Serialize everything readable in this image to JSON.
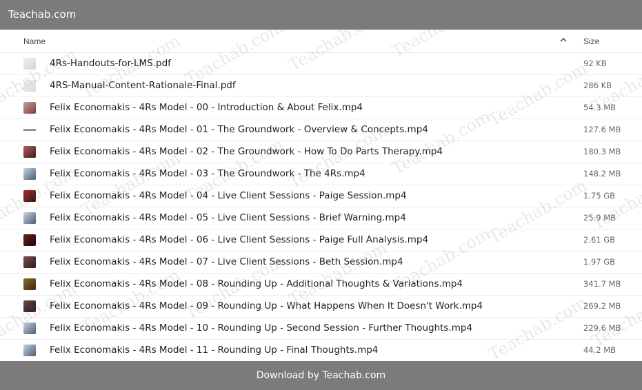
{
  "site_title": "Teachab.com",
  "columns": {
    "name": "Name",
    "size": "Size"
  },
  "files": [
    {
      "name": "4Rs-Handouts-for-LMS.pdf",
      "size": "92 KB",
      "thumb": "doc-thumbnail"
    },
    {
      "name": "4RS-Manual-Content-Rationale-Final.pdf",
      "size": "286 KB",
      "thumb": "doc-thumbnail"
    },
    {
      "name": "Felix Economakis - 4Rs Model - 00 - Introduction & About Felix.mp4",
      "size": "54.3 MB",
      "thumb": "video-thumbnail"
    },
    {
      "name": "Felix Economakis - 4Rs Model - 01 - The Groundwork - Overview & Concepts.mp4",
      "size": "127.6 MB",
      "thumb": "video-thumbnail"
    },
    {
      "name": "Felix Economakis - 4Rs Model - 02 - The Groundwork - How To Do Parts Therapy.mp4",
      "size": "180.3 MB",
      "thumb": "video-thumbnail"
    },
    {
      "name": "Felix Economakis - 4Rs Model - 03 - The Groundwork - The 4Rs.mp4",
      "size": "148.2 MB",
      "thumb": "video-thumbnail"
    },
    {
      "name": "Felix Economakis - 4Rs Model - 04 - Live Client Sessions - Paige Session.mp4",
      "size": "1.75 GB",
      "thumb": "video-thumbnail"
    },
    {
      "name": "Felix Economakis - 4Rs Model - 05 - Live Client Sessions - Brief Warning.mp4",
      "size": "25.9 MB",
      "thumb": "video-thumbnail"
    },
    {
      "name": "Felix Economakis - 4Rs Model - 06 - Live Client Sessions - Paige Full Analysis.mp4",
      "size": "2.61 GB",
      "thumb": "video-thumbnail"
    },
    {
      "name": "Felix Economakis - 4Rs Model - 07 - Live Client Sessions - Beth Session.mp4",
      "size": "1.97 GB",
      "thumb": "video-thumbnail"
    },
    {
      "name": "Felix Economakis - 4Rs Model - 08 - Rounding Up - Additional Thoughts & Variations.mp4",
      "size": "341.7 MB",
      "thumb": "video-thumbnail"
    },
    {
      "name": "Felix Economakis - 4Rs Model - 09 - Rounding Up - What Happens When It Doesn't Work.mp4",
      "size": "269.2 MB",
      "thumb": "video-thumbnail"
    },
    {
      "name": "Felix Economakis - 4Rs Model - 10 - Rounding Up - Second Session - Further Thoughts.mp4",
      "size": "229.6 MB",
      "thumb": "video-thumbnail"
    },
    {
      "name": "Felix Economakis - 4Rs Model - 11 - Rounding Up - Final Thoughts.mp4",
      "size": "44.2 MB",
      "thumb": "video-thumbnail"
    }
  ],
  "footer_label": "Download by Teachab.com",
  "watermark_text": "Teachab.com",
  "colors": {
    "bar": "#7b7b7b"
  }
}
